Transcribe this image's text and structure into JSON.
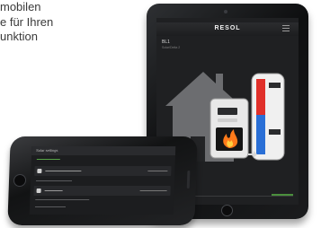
{
  "intro": {
    "lines": [
      "mobilen",
      "e für Ihren",
      "unktion"
    ]
  },
  "tablet": {
    "brand_logo": "RESOL",
    "device_name": "BL1",
    "device_subtitle": "Solar/Delta 2"
  },
  "phone": {
    "header_text": "Solar settings",
    "row_a_label": "Select controller",
    "row_b_label": "Status"
  },
  "colors": {
    "hot": "#e0302a",
    "cold": "#2a6fd6",
    "accent": "#56a346",
    "flame": "#ff7a1a"
  }
}
